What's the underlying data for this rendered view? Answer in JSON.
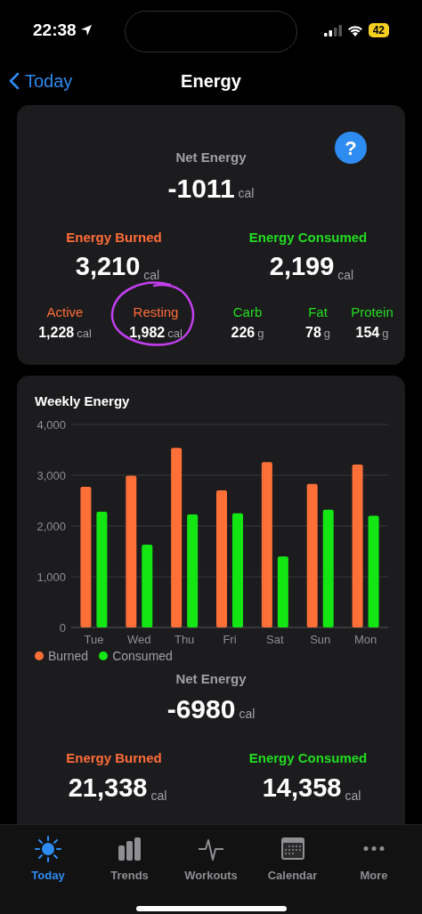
{
  "status_bar": {
    "time": "22:38",
    "battery": "42"
  },
  "nav": {
    "back": "Today",
    "title": "Energy"
  },
  "summary": {
    "net_label": "Net Energy",
    "net_value": "-1011",
    "net_unit": "cal",
    "help": "?",
    "totals": [
      {
        "kind": "burned",
        "label": "Energy Burned",
        "value": "3,210",
        "unit": "cal"
      },
      {
        "kind": "consumed",
        "label": "Energy Consumed",
        "value": "2,199",
        "unit": "cal"
      }
    ],
    "breakdown": [
      {
        "kind": "burned",
        "label": "Active",
        "value": "1,228",
        "unit": "cal",
        "circled": false
      },
      {
        "kind": "burned",
        "label": "Resting",
        "value": "1,982",
        "unit": "cal",
        "circled": true
      },
      {
        "kind": "consumed",
        "label": "Carb",
        "value": "226",
        "unit": "g",
        "circled": false
      },
      {
        "kind": "consumed",
        "label": "Fat",
        "value": "78",
        "unit": "g",
        "circled": false
      },
      {
        "kind": "consumed",
        "label": "Protein",
        "value": "154",
        "unit": "g",
        "circled": false
      }
    ]
  },
  "weekly": {
    "title": "Weekly Energy",
    "chart_data": {
      "type": "bar",
      "grid": true,
      "categories": [
        "Tue",
        "Wed",
        "Thu",
        "Fri",
        "Sat",
        "Sun",
        "Mon"
      ],
      "ylim": [
        0,
        4000
      ],
      "yticks": [
        {
          "value": 0,
          "label": "0"
        },
        {
          "value": 1000,
          "label": "1,000"
        },
        {
          "value": 2000,
          "label": "2,000"
        },
        {
          "value": 3000,
          "label": "3,000"
        },
        {
          "value": 4000,
          "label": "4,000"
        }
      ],
      "series": [
        {
          "name": "Burned",
          "color": "#ff7038",
          "values": [
            2770,
            2990,
            3540,
            2700,
            3260,
            2830,
            3210
          ]
        },
        {
          "name": "Consumed",
          "color": "#14e614",
          "values": [
            2280,
            1630,
            2230,
            2250,
            1400,
            2320,
            2200
          ]
        }
      ]
    },
    "net_label": "Net Energy",
    "net_value": "-6980",
    "net_unit": "cal",
    "totals": [
      {
        "kind": "burned",
        "label": "Energy Burned",
        "value": "21,338",
        "unit": "cal"
      },
      {
        "kind": "consumed",
        "label": "Energy Consumed",
        "value": "14,358",
        "unit": "cal"
      }
    ]
  },
  "tab_bar": [
    {
      "kind": "today",
      "label": "Today",
      "selected": true
    },
    {
      "kind": "trends",
      "label": "Trends",
      "selected": false
    },
    {
      "kind": "workouts",
      "label": "Workouts",
      "selected": false
    },
    {
      "kind": "calendar",
      "label": "Calendar",
      "selected": false
    },
    {
      "kind": "more",
      "label": "More",
      "selected": false
    }
  ]
}
